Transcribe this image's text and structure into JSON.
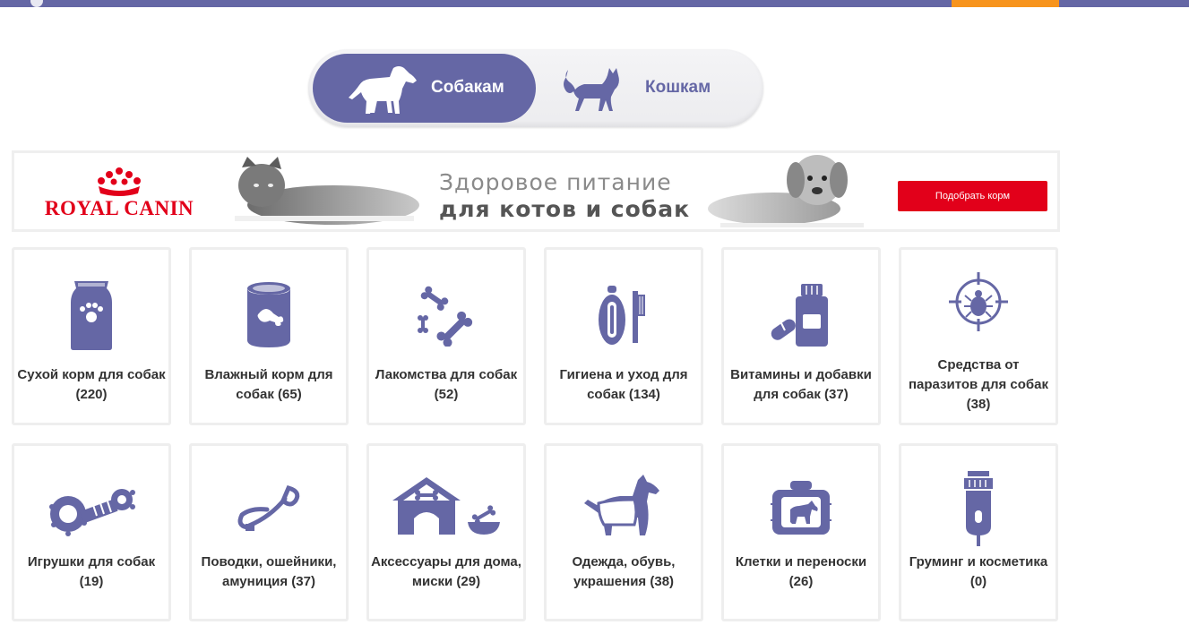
{
  "header": {
    "accent": "#6567a5",
    "cta_color": "#f7941d"
  },
  "pet_switch": {
    "dogs_label": "Собакам",
    "cats_label": "Кошкам",
    "active": "dogs",
    "dogs_icon": "dog-icon",
    "cats_icon": "cat-icon"
  },
  "banner": {
    "brand": "ROYAL CANIN",
    "line1": "Здоровое питание",
    "line2": "для котов и собак",
    "button_label": "Подобрать корм",
    "button_color": "#e2001a"
  },
  "categories": [
    {
      "label": "Сухой корм для собак",
      "count": "(220)",
      "icon": "dry-food-bag-icon"
    },
    {
      "label": "Влажный корм для собак (65)",
      "icon": "wet-food-can-icon"
    },
    {
      "label": "Лакомства для собак",
      "count": "(52)",
      "icon": "treats-bones-icon"
    },
    {
      "label": "Гигиена и уход для собак (134)",
      "icon": "hygiene-brush-icon"
    },
    {
      "label": "Витамины и добавки для собак (37)",
      "icon": "vitamins-bottle-icon"
    },
    {
      "label": "Средства от паразитов для собак",
      "count": "(38)",
      "icon": "parasite-tick-icon"
    },
    {
      "label": "Игрушки для собак",
      "count": "(19)",
      "icon": "toy-icon"
    },
    {
      "label": "Поводки, ошейники, амуниция (37)",
      "icon": "leash-icon"
    },
    {
      "label": "Аксессуары для дома, миски (29)",
      "icon": "doghouse-bowl-icon"
    },
    {
      "label": "Одежда, обувь, украшения (38)",
      "icon": "dog-clothes-icon"
    },
    {
      "label": "Клетки и переноски",
      "count": "(26)",
      "icon": "carrier-icon"
    },
    {
      "label": "Груминг и косметика",
      "count": "(0)",
      "icon": "clipper-icon"
    }
  ]
}
